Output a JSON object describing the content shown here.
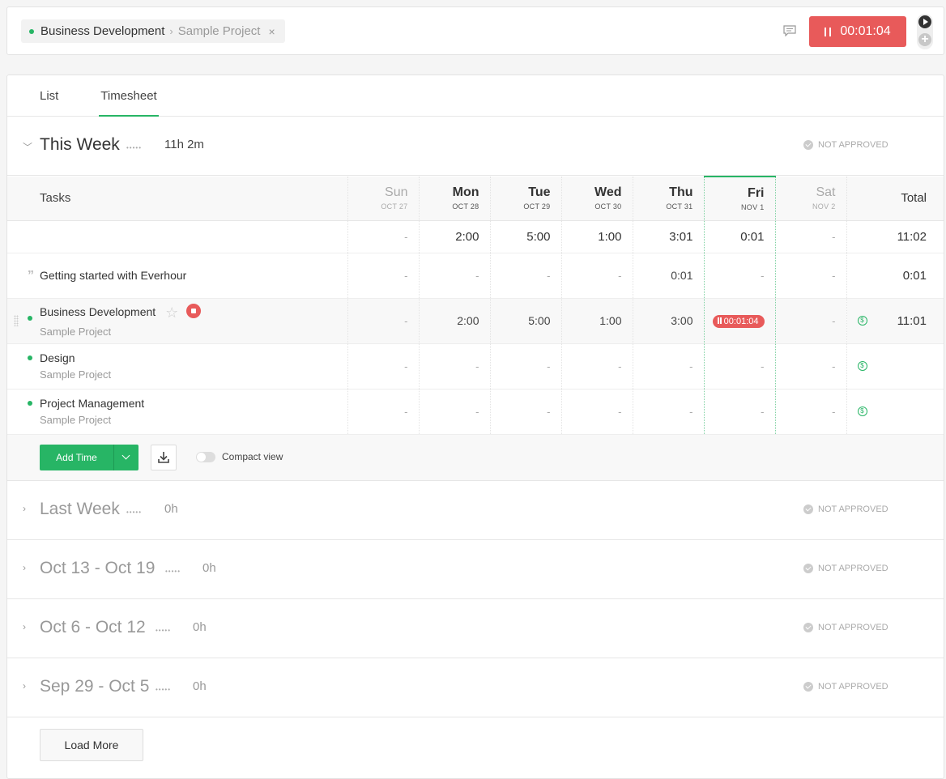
{
  "topbar": {
    "project": "Business Development",
    "separator": "›",
    "subproject": "Sample Project",
    "close_icon": "×",
    "timer_label": "00:01:04",
    "accent_color": "#e85a5a",
    "icons": [
      "comment-icon",
      "pause-icon",
      "play-icon",
      "plus-icon"
    ]
  },
  "tabs": [
    {
      "label": "List",
      "active": false
    },
    {
      "label": "Timesheet",
      "active": true
    }
  ],
  "this_week": {
    "title": "This Week",
    "dots": "•••••",
    "hours": "11h 2m",
    "status": "NOT APPROVED"
  },
  "grid": {
    "tasks_header": "Tasks",
    "days": [
      {
        "name": "Sun",
        "date": "OCT 27",
        "muted": true
      },
      {
        "name": "Mon",
        "date": "OCT 28",
        "muted": false
      },
      {
        "name": "Tue",
        "date": "OCT 29",
        "muted": false
      },
      {
        "name": "Wed",
        "date": "OCT 30",
        "muted": false
      },
      {
        "name": "Thu",
        "date": "OCT 31",
        "muted": false
      },
      {
        "name": "Fri",
        "date": "NOV 1",
        "muted": false,
        "today": true
      },
      {
        "name": "Sat",
        "date": "NOV 2",
        "muted": true
      }
    ],
    "total_header": "Total",
    "summary": [
      "-",
      "2:00",
      "5:00",
      "1:00",
      "3:01",
      "0:01",
      "-"
    ],
    "summary_total": "11:02",
    "rows": [
      {
        "name": "Getting started with Everhour",
        "sub": "",
        "values": [
          "-",
          "-",
          "-",
          "-",
          "0:01",
          "-",
          "-"
        ],
        "total": "0:01"
      },
      {
        "name": "Business Development",
        "sub": "Sample Project",
        "values": [
          "-",
          "2:00",
          "5:00",
          "1:00",
          "3:00",
          "00:01:04",
          "-"
        ],
        "total": "11:01",
        "running": true
      },
      {
        "name": "Design",
        "sub": "Sample Project",
        "values": [
          "-",
          "-",
          "-",
          "-",
          "-",
          "-",
          "-"
        ],
        "total": ""
      },
      {
        "name": "Project Management",
        "sub": "Sample Project",
        "values": [
          "-",
          "-",
          "-",
          "-",
          "-",
          "-",
          "-"
        ],
        "total": ""
      }
    ]
  },
  "actions": {
    "add_time": "Add Time",
    "compact_view": "Compact view",
    "compact_enabled": false
  },
  "past_weeks": [
    {
      "title": "Last Week",
      "dots": "•••••",
      "hours": "0h",
      "status": "NOT APPROVED"
    },
    {
      "title": "Oct 13 - Oct 19",
      "dots": "•••••",
      "hours": "0h",
      "status": "NOT APPROVED"
    },
    {
      "title": "Oct 6 - Oct 12",
      "dots": "•••••",
      "hours": "0h",
      "status": "NOT APPROVED"
    },
    {
      "title": "Sep 29 - Oct 5",
      "dots": "•••••",
      "hours": "0h",
      "status": "NOT APPROVED"
    }
  ],
  "load_more": "Load More",
  "colors": {
    "green": "#27b565",
    "red": "#e85a5a"
  }
}
